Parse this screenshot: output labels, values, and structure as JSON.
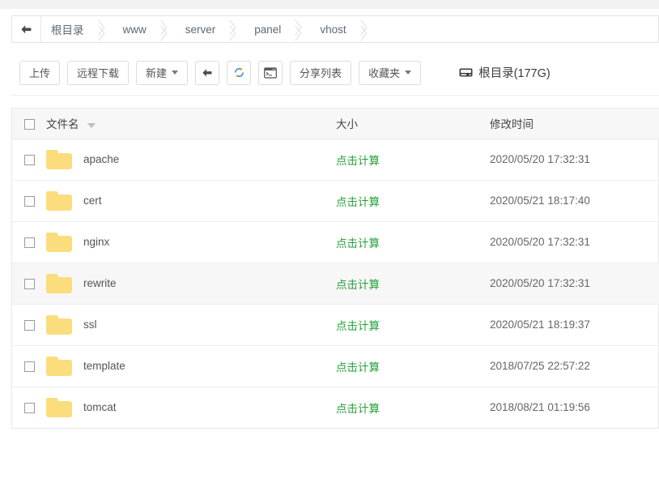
{
  "breadcrumb": {
    "back_icon": "arrow-left-icon",
    "items": [
      "根目录",
      "www",
      "server",
      "panel",
      "vhost"
    ]
  },
  "toolbar": {
    "buttons": [
      {
        "label": "上传",
        "type": "text",
        "icon": ""
      },
      {
        "label": "远程下载",
        "type": "text",
        "icon": ""
      },
      {
        "label": "新建",
        "type": "dropdown",
        "icon": ""
      },
      {
        "label": "",
        "type": "icon",
        "icon": "arrow-left-icon"
      },
      {
        "label": "",
        "type": "icon",
        "icon": "refresh-icon"
      },
      {
        "label": "",
        "type": "icon",
        "icon": "terminal-icon"
      },
      {
        "label": "分享列表",
        "type": "text",
        "icon": ""
      },
      {
        "label": "收藏夹",
        "type": "dropdown",
        "icon": ""
      }
    ],
    "disk": {
      "icon": "hard-drive-icon",
      "label": "根目录(177G)"
    }
  },
  "table": {
    "headers": {
      "name": "文件名",
      "size": "大小",
      "time": "修改时间"
    },
    "rows": [
      {
        "name": "apache",
        "size": "点击计算",
        "time": "2020/05/20 17:32:31",
        "highlighted": false
      },
      {
        "name": "cert",
        "size": "点击计算",
        "time": "2020/05/21 18:17:40",
        "highlighted": false
      },
      {
        "name": "nginx",
        "size": "点击计算",
        "time": "2020/05/20 17:32:31",
        "highlighted": false
      },
      {
        "name": "rewrite",
        "size": "点击计算",
        "time": "2020/05/20 17:32:31",
        "highlighted": true
      },
      {
        "name": "ssl",
        "size": "点击计算",
        "time": "2020/05/21 18:19:37",
        "highlighted": false
      },
      {
        "name": "template",
        "size": "点击计算",
        "time": "2018/07/25 22:57:22",
        "highlighted": false
      },
      {
        "name": "tomcat",
        "size": "点击计算",
        "time": "2018/08/21 01:19:56",
        "highlighted": false
      }
    ]
  },
  "colors": {
    "accent_green": "#25a03a",
    "folder_yellow": "#fbdd7e",
    "breadcrumb_text": "#5b6a78",
    "header_bg": "#f7f7f7"
  }
}
